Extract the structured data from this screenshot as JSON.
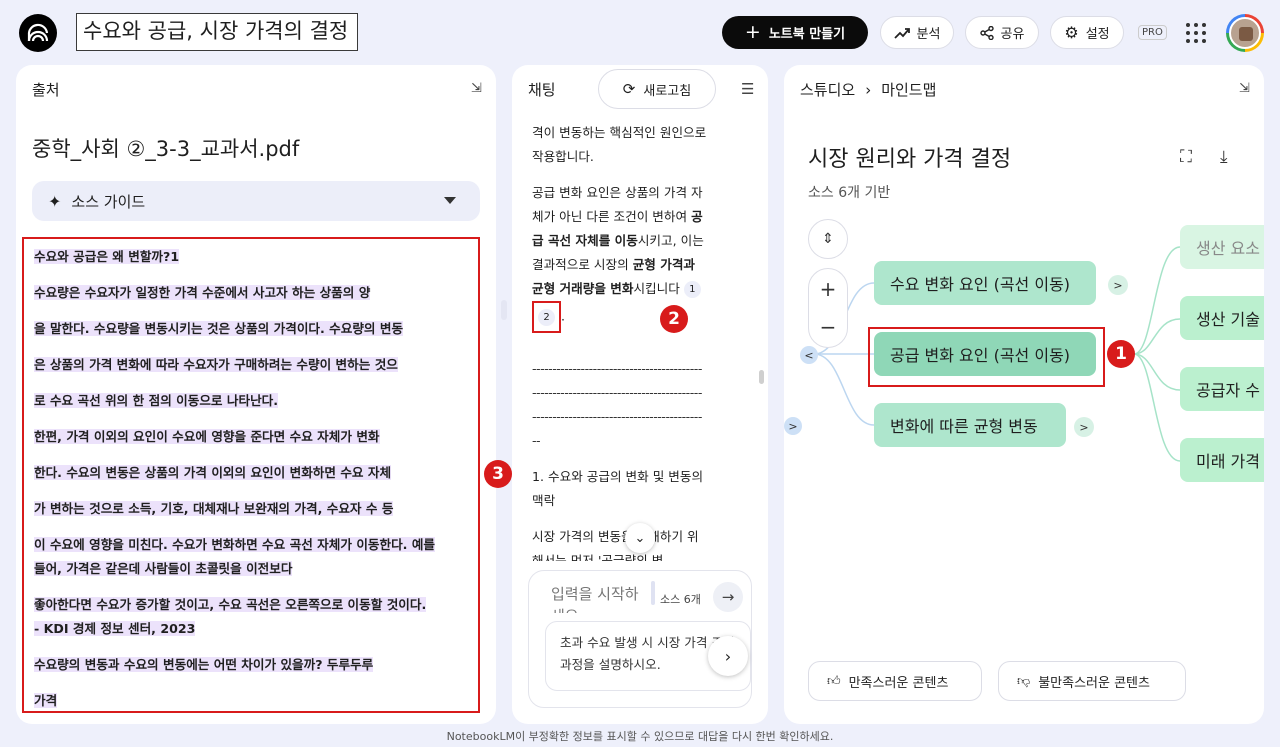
{
  "header": {
    "notebook_title": "수요와 공급, 시장 가격의 결정",
    "new_notebook_label": "노트북 만들기",
    "analytics_label": "분석",
    "share_label": "공유",
    "settings_label": "설정",
    "pro_badge": "PRO"
  },
  "source_panel": {
    "header": "출처",
    "file_title": "중학_사회 ②_3-3_교과서.pdf",
    "guide_label": "소스 가이드",
    "lines": [
      "수요와 공급은 왜 변할까?1",
      "수요량은 수요자가 일정한 가격 수준에서 사고자 하는 상품의 양",
      "을 말한다. 수요량을 변동시키는 것은 상품의 가격이다. 수요량의 변동",
      "은 상품의 가격 변화에 따라 수요자가 구매하려는 수량이 변하는 것으",
      "로 수요 곡선 위의 한 점의 이동으로 나타난다.",
      "한편, 가격 이외의 요인이 수요에 영향을 준다면 수요 자체가 변화",
      "한다. 수요의 변동은 상품의 가격 이외의 요인이 변화하면 수요 자체",
      "가 변하는 것으로 소득, 기호, 대체재나 보완재의 가격, 수요자 수 등",
      "이 수요에 영향을 미친다. 수요가 변화하면 수요 곡선 자체가 이동한다. 예를",
      "들어, 가격은 같은데 사람들이 초콜릿을 이전보다",
      "좋아한다면 수요가 증가할 것이고, 수요 곡선은 오른쪽으로 이동할 것이다.",
      "- KDI 경제 정보 센터, 2023",
      "수요량의 변동과 수요의 변동에는 어떤 차이가 있을까? 두루두루",
      "가격"
    ]
  },
  "chat_panel": {
    "header": "채팅",
    "refresh_label": "새로고침",
    "p1": "격이 변동하는 핵심적인 원인으로 작용합니다.",
    "p2_a": "공급 변화 요인은 상품의 가격 자체가 아닌 다른 조건이 변하여 ",
    "p2_b": "공급 곡선 자체를 이동",
    "p2_c": "시키고, 이는 결과적으로 시장의 ",
    "p2_d": "균형 가격과 균형 거래량을 변화",
    "p2_e": "시킵니다",
    "cite1": "1",
    "cite2": "2",
    "dash1": "------------------------------------------",
    "dash2": "------------------------------------------",
    "dash3": "------------------------------------------",
    "dash4": "--",
    "p3": "1. 수요와 공급의 변화 및 변동의 맥락",
    "p4": "시장 가격의 변동을 이해하기 위해서는 먼저 '공급량의 변",
    "input_placeholder": "입력을 시작하세요...",
    "source_count": "소스 6개",
    "suggestion": "초과 수요 발생 시 시장 가격 조정 과정을 설명하시오."
  },
  "studio_panel": {
    "crumb_root": "스튜디오",
    "crumb_current": "마인드맵",
    "mindmap_title": "시장 원리와 가격 결정",
    "mindmap_subtitle": "소스 6개 기반",
    "nodes": {
      "demand": "수요 변화 요인 (곡선 이동)",
      "supply": "공급 변화 요인 (곡선 이동)",
      "equilibrium": "변화에 따른 균형 변동",
      "leaf1": "생산 요소 가격",
      "leaf2": "생산 기술 발전",
      "leaf3": "공급자 수",
      "leaf4": "미래 가격 예상"
    },
    "good_label": "만족스러운 콘텐츠",
    "bad_label": "불만족스러운 콘텐츠"
  },
  "annotations": {
    "badge1": "1",
    "badge2": "2",
    "badge3": "3"
  },
  "footer": {
    "disclaimer": "NotebookLM이 부정확한 정보를 표시할 수 있으므로 대답을 다시 한번 확인하세요."
  },
  "colors": {
    "page_bg": "#eef0fb",
    "highlight": "#ece2fb",
    "node_green": "#aee6cd",
    "annotation_red": "#d81b1b"
  }
}
